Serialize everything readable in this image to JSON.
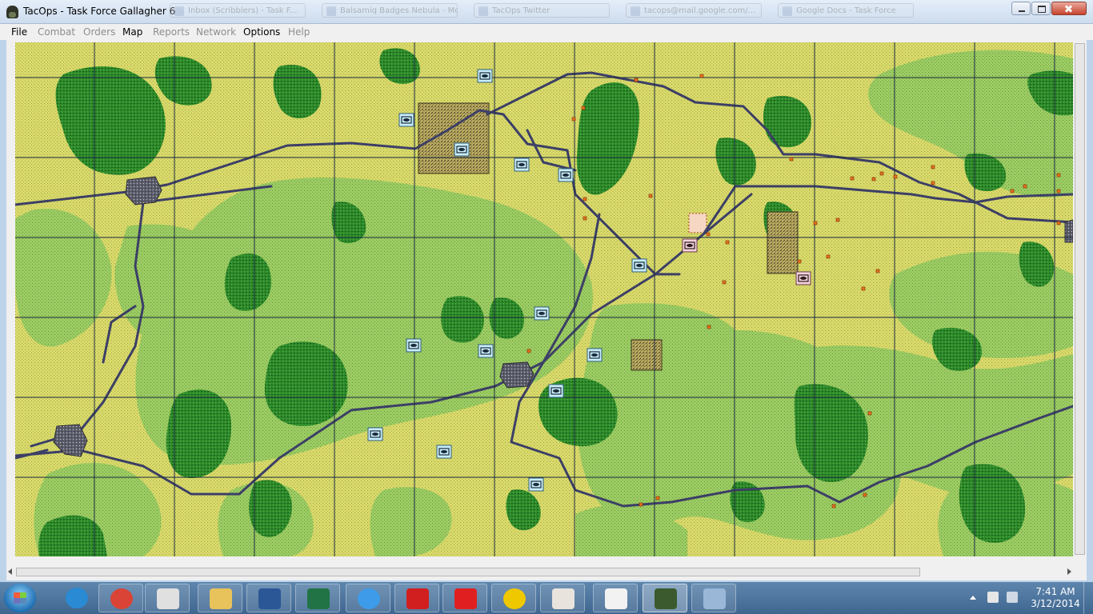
{
  "window": {
    "title": "TacOps - Task Force Gallagher 6",
    "background_tabs": [
      "Inbox (Scribblers) - Task F...",
      "Balsamiq Badges Nebula - Mozi...",
      "TacOps Twitter",
      "tacops@mail.google.com/...",
      "Google Docs - Task Force"
    ]
  },
  "menu": {
    "items": [
      {
        "label": "File",
        "enabled": true
      },
      {
        "label": "Combat",
        "enabled": false
      },
      {
        "label": "Orders",
        "enabled": false
      },
      {
        "label": "Map",
        "enabled": true
      },
      {
        "label": "Reports",
        "enabled": false
      },
      {
        "label": "Network",
        "enabled": false
      },
      {
        "label": "Options",
        "enabled": true
      },
      {
        "label": "Help",
        "enabled": false
      }
    ]
  },
  "map": {
    "grid": {
      "cols": 13,
      "rows": 7
    },
    "colors": {
      "open_ground": "#d8d868",
      "light_vegetation": "#a2cc68",
      "dense_woods": "#2f8a2c",
      "road": "#3c3f66",
      "town": "#5a5a6a",
      "friendly_unit": "#c9eefb",
      "enemy_unit": "#f2d0dc",
      "enemy_marker": "#e8731a"
    },
    "friendly_units_count": 17,
    "enemy_units_count": 3
  },
  "taskbar": {
    "apps": [
      {
        "name": "internet-explorer-icon",
        "color": "#2a8ad4"
      },
      {
        "name": "chrome-icon",
        "color": "#d94436"
      },
      {
        "name": "scanner-app-icon",
        "color": "#e0e0e0"
      },
      {
        "name": "windows-explorer-icon",
        "color": "#e8c25a"
      },
      {
        "name": "word-icon",
        "color": "#2b5797"
      },
      {
        "name": "excel-icon",
        "color": "#217346"
      },
      {
        "name": "itunes-icon",
        "color": "#3d9be9"
      },
      {
        "name": "acrobat-icon",
        "color": "#d11f1f"
      },
      {
        "name": "splat-app-icon",
        "color": "#e02020"
      },
      {
        "name": "globe-app-icon",
        "color": "#f0c800"
      },
      {
        "name": "slack-icon",
        "color": "#e8e3dd"
      },
      {
        "name": "app-grid-icon",
        "color": "#f2f2f2"
      },
      {
        "name": "tacops-soldier-icon",
        "color": "#3b5a2e"
      },
      {
        "name": "paint-icon",
        "color": "#9ab7d8"
      }
    ],
    "clock": {
      "time": "7:41 AM",
      "date": "3/12/2014"
    }
  }
}
